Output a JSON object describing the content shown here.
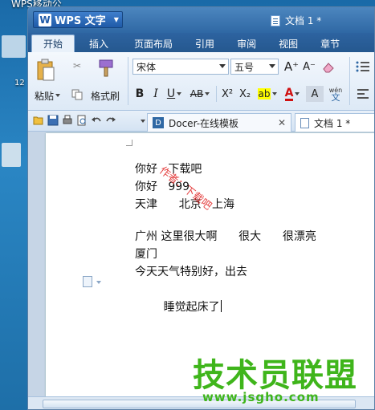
{
  "desktop": {
    "label": "WPS移动公",
    "num": "12"
  },
  "window": {
    "app_name": "WPS 文字",
    "doc_title": "文档 1 *"
  },
  "tabs": [
    "开始",
    "插入",
    "页面布局",
    "引用",
    "审阅",
    "视图",
    "章节"
  ],
  "ribbon": {
    "paste_label": "粘贴",
    "format_painter_label": "格式刷",
    "font_name": "宋体",
    "font_size": "五号",
    "bold": "B",
    "italic": "I",
    "underline": "U",
    "strike": "AB",
    "superscript": "X²",
    "subscript": "X₂",
    "font_color": "A",
    "grow_font": "A⁺",
    "shrink_font": "A⁻",
    "highlight": "ab",
    "char_shading": "A",
    "pinyin": "wén"
  },
  "doc_tabs": [
    {
      "label": "Docer-在线模板"
    },
    {
      "label": "文档 1 *"
    }
  ],
  "document": {
    "lines": [
      "你好   下载吧",
      "你好   999",
      "天津      北京   上海",
      "",
      "广州 这里很大啊      很大      很漂亮",
      "厦门",
      "今天天气特别好，出去",
      "睡觉起床了"
    ],
    "stamp_text": "作者：下载吧"
  },
  "watermark": {
    "title": "技术员联盟",
    "url": "www.jsgho.com"
  },
  "colors": {
    "titlebar": "#2f68a4",
    "tabsbar": "#25588f",
    "ribbon_bg": "#dde9f6",
    "stamp": "#e02020",
    "watermark": "#3fb51b"
  }
}
